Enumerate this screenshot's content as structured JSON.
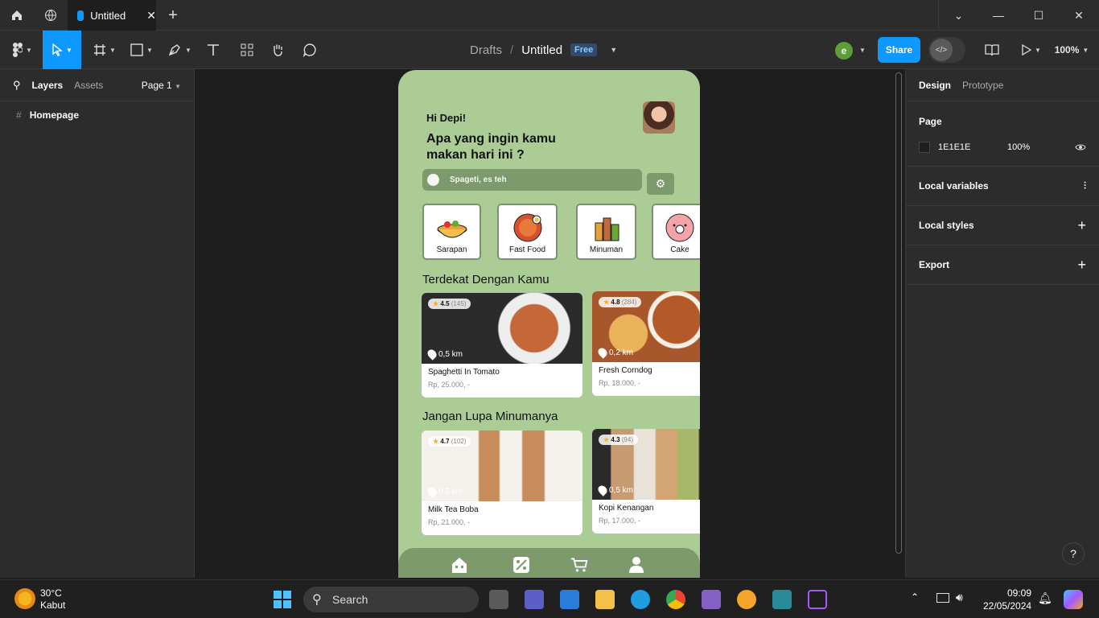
{
  "titlebar": {
    "tab_title": "Untitled"
  },
  "toolbar": {
    "crumb_drafts": "Drafts",
    "crumb_sep": "/",
    "crumb_file": "Untitled",
    "badge": "Free",
    "avatar_initial": "e",
    "share_label": "Share",
    "zoom": "100%"
  },
  "left_panel": {
    "tab_layers": "Layers",
    "tab_assets": "Assets",
    "page_selector": "Page 1",
    "layers": [
      {
        "label": "Homepage"
      }
    ]
  },
  "right_panel": {
    "tab_design": "Design",
    "tab_prototype": "Prototype",
    "page_heading": "Page",
    "page_color": "1E1E1E",
    "page_opacity": "100%",
    "local_variables": "Local variables",
    "local_styles": "Local styles",
    "export": "Export"
  },
  "app": {
    "greeting": "Hi Depi!",
    "question": "Apa yang ingin kamu makan hari ini ?",
    "search_placeholder": "Spageti, es teh",
    "categories": [
      {
        "label": "Sarapan"
      },
      {
        "label": "Fast Food"
      },
      {
        "label": "Minuman"
      },
      {
        "label": "Cake"
      }
    ],
    "section_nearby": "Terdekat Dengan Kamu",
    "section_drinks": "Jangan Lupa Minumanya",
    "nearby": [
      {
        "rating": "4.5",
        "count": "(145)",
        "distance": "0,5 km",
        "name": "Spaghetti In Tomato",
        "price": "Rp, 25.000, -"
      },
      {
        "rating": "4.8",
        "count": "(284)",
        "distance": "0,2 km",
        "name": "Fresh Corndog",
        "price": "Rp, 18.000, -"
      }
    ],
    "drinks": [
      {
        "rating": "4.7",
        "count": "(102)",
        "distance": "0,5 km",
        "name": "Milk Tea Boba",
        "price": "Rp, 21.000, -"
      },
      {
        "rating": "4.3",
        "count": "(94)",
        "distance": "0,5 km",
        "name": "Kopi Kenangan",
        "price": "Rp, 17.000, -"
      }
    ]
  },
  "taskbar": {
    "weather_temp": "30°C",
    "weather_desc": "Kabut",
    "search_label": "Search",
    "time": "09:09",
    "date": "22/05/2024"
  },
  "help": "?"
}
